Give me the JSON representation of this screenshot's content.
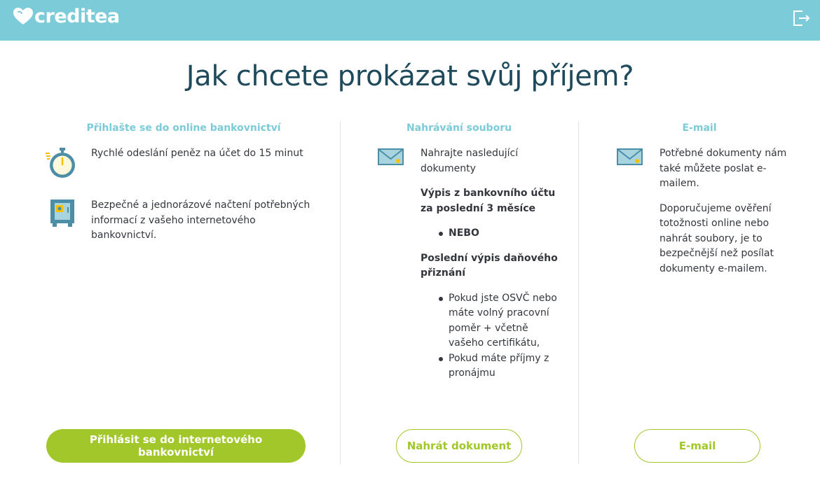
{
  "header": {
    "brand": "creditea",
    "logout_icon": "logout-icon",
    "background": "#7ccbd8"
  },
  "title": "Jak chcete prokázat svůj příjem?",
  "columns": {
    "bank": {
      "title": "Přihlašte se do online bankovnictví",
      "feature1": {
        "icon": "stopwatch-icon",
        "text": "Rychlé odeslání peněz na účet do 15 minut"
      },
      "feature2": {
        "icon": "safe-icon",
        "text": "Bezpečné a jednorázové načtení potřebných informací z vašeho internetového bankovnictví."
      },
      "button": "Přihlásit se do internetového bankovnictví"
    },
    "upload": {
      "title": "Nahrávání souboru",
      "icon": "envelope-icon",
      "intro": "Nahrajte nasledující dokumenty",
      "doc1": "Výpis z bankovního účtu za poslední 3 měsíce",
      "or": "NEBO",
      "doc2": "Poslední výpis daňového přiznání",
      "bullets": [
        "Pokud jste OSVČ nebo máte volný pracovní poměr + včetně vašeho certifikátu,",
        "Pokud máte příjmy z pronájmu"
      ],
      "button": "Nahrát dokument"
    },
    "email": {
      "title": "E-mail",
      "icon": "envelope-icon",
      "text1": "Potřebné dokumenty nám také můžete poslat e-mailem.",
      "text2": "Doporučujeme ověření totožnosti online nebo nahrát soubory, je to bezpečnější než posílat dokumenty e-mailem.",
      "button": "E-mail"
    }
  },
  "colors": {
    "accent": "#7ccbd8",
    "button_green": "#a1c72a",
    "title": "#1f4a5c",
    "icon_blue": "#4b8ea6"
  }
}
